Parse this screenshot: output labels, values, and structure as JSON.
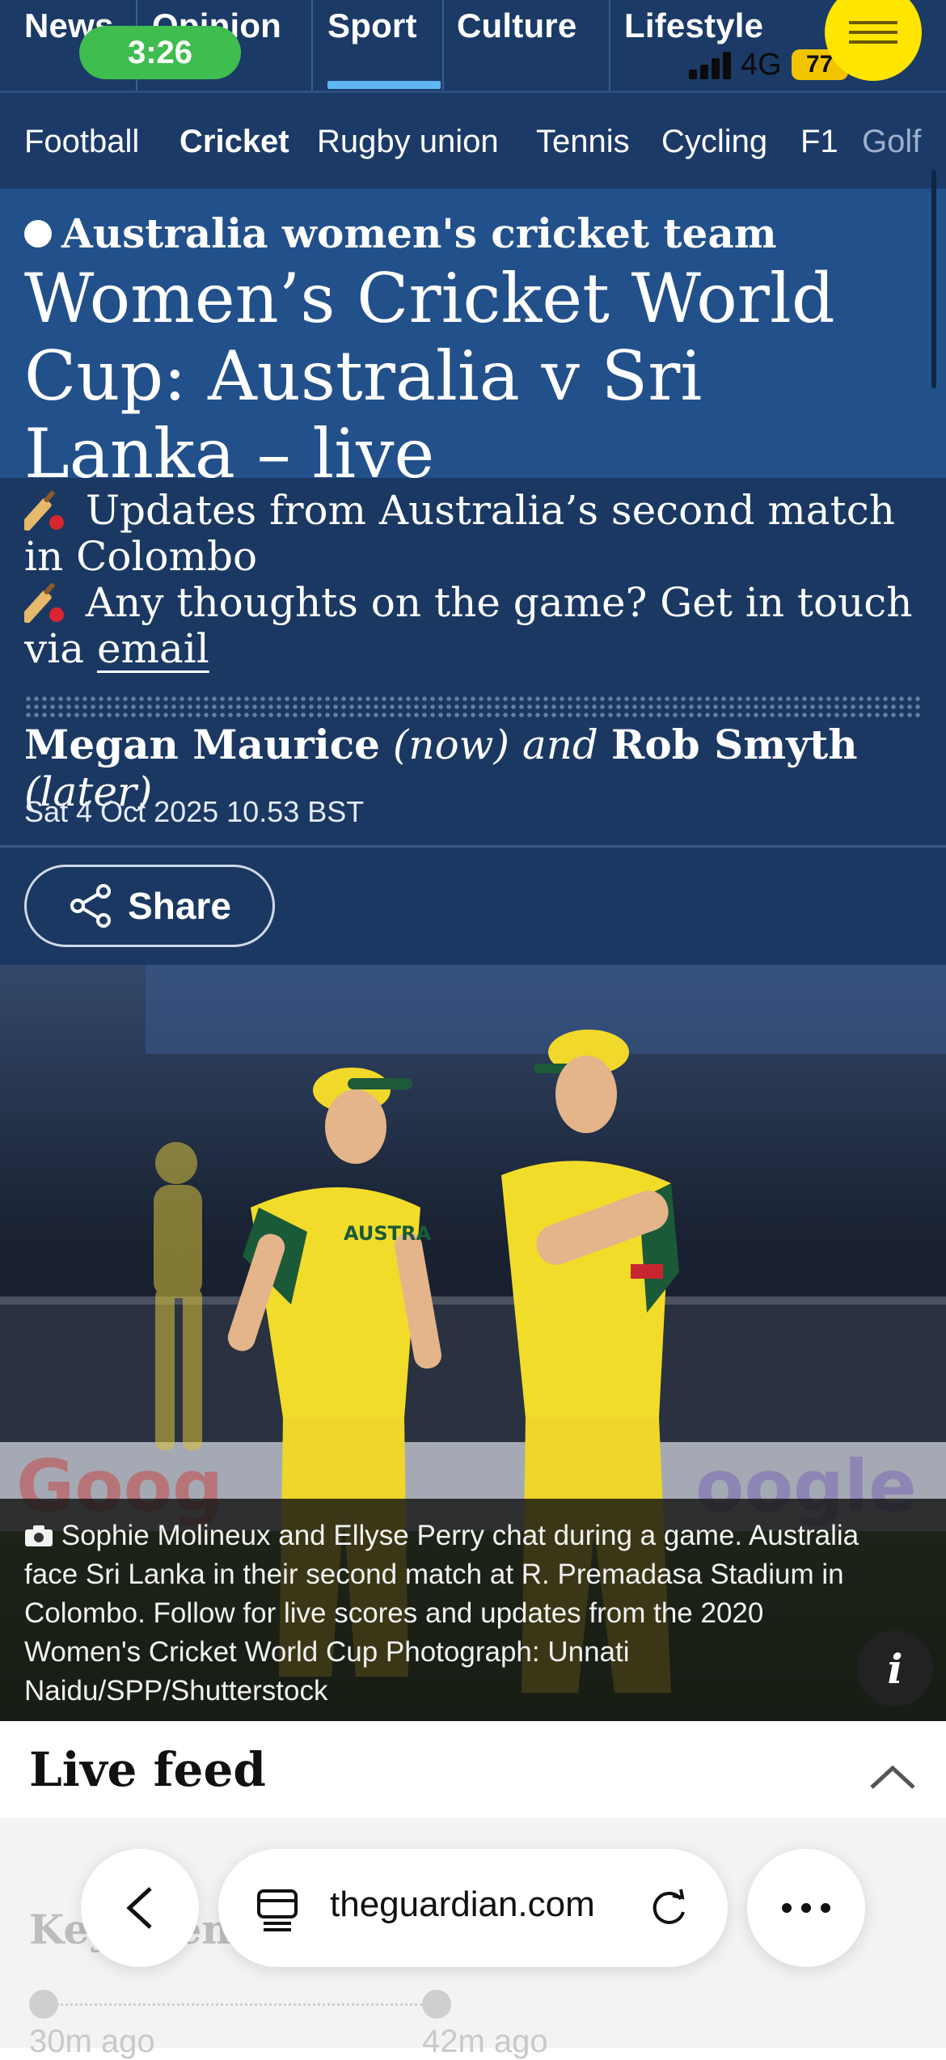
{
  "status_bar": {
    "time": "3:26",
    "network": "4G",
    "battery": "77"
  },
  "top_nav": {
    "items": [
      "News",
      "Opinion",
      "Sport",
      "Culture",
      "Lifestyle"
    ],
    "active": "Sport"
  },
  "sub_nav": {
    "items": [
      "Football",
      "Cricket",
      "Rugby union",
      "Tennis",
      "Cycling",
      "F1",
      "Golf"
    ],
    "active": "Cricket"
  },
  "article": {
    "kicker": "Australia women's cricket team",
    "headline": "Women’s Cricket World Cup: Australia v Sri Lanka – live",
    "standfirst": [
      {
        "icon": "cricket-bat-icon",
        "text": "Updates from Australia’s second match in Colombo"
      },
      {
        "icon": "cricket-bat-icon",
        "text_before_link": "Any thoughts on the game? Get in touch via",
        "link": "email"
      }
    ],
    "byline": {
      "author1": "Megan Maurice",
      "when1": "(now)",
      "conjunction": "and",
      "author2": "Rob Smyth",
      "when2": "(later)"
    },
    "date": "Sat 4 Oct 2025 10.53 BST",
    "share_label": "Share",
    "caption": "Sophie Molineux and Ellyse Perry chat during a game. Australia face Sri Lanka in their second match at R. Premadasa Stadium in Colombo. Follow for live scores and updates from the 2020 Women's Cricket World Cup Photograph: Unnati Naidu/SPP/Shutterstock",
    "info_label": "i"
  },
  "live_feed": {
    "title": "Live feed",
    "key_events_label": "Key events",
    "times": [
      "30m ago",
      "42m ago"
    ]
  },
  "browser": {
    "host": "theguardian.com"
  },
  "colors": {
    "nav_bg": "#1b3a66",
    "headline_bg": "#22508a",
    "standfirst_bg": "#1a3862",
    "accent_underline": "#5fb8f3",
    "menu_yellow": "#ffe500"
  }
}
